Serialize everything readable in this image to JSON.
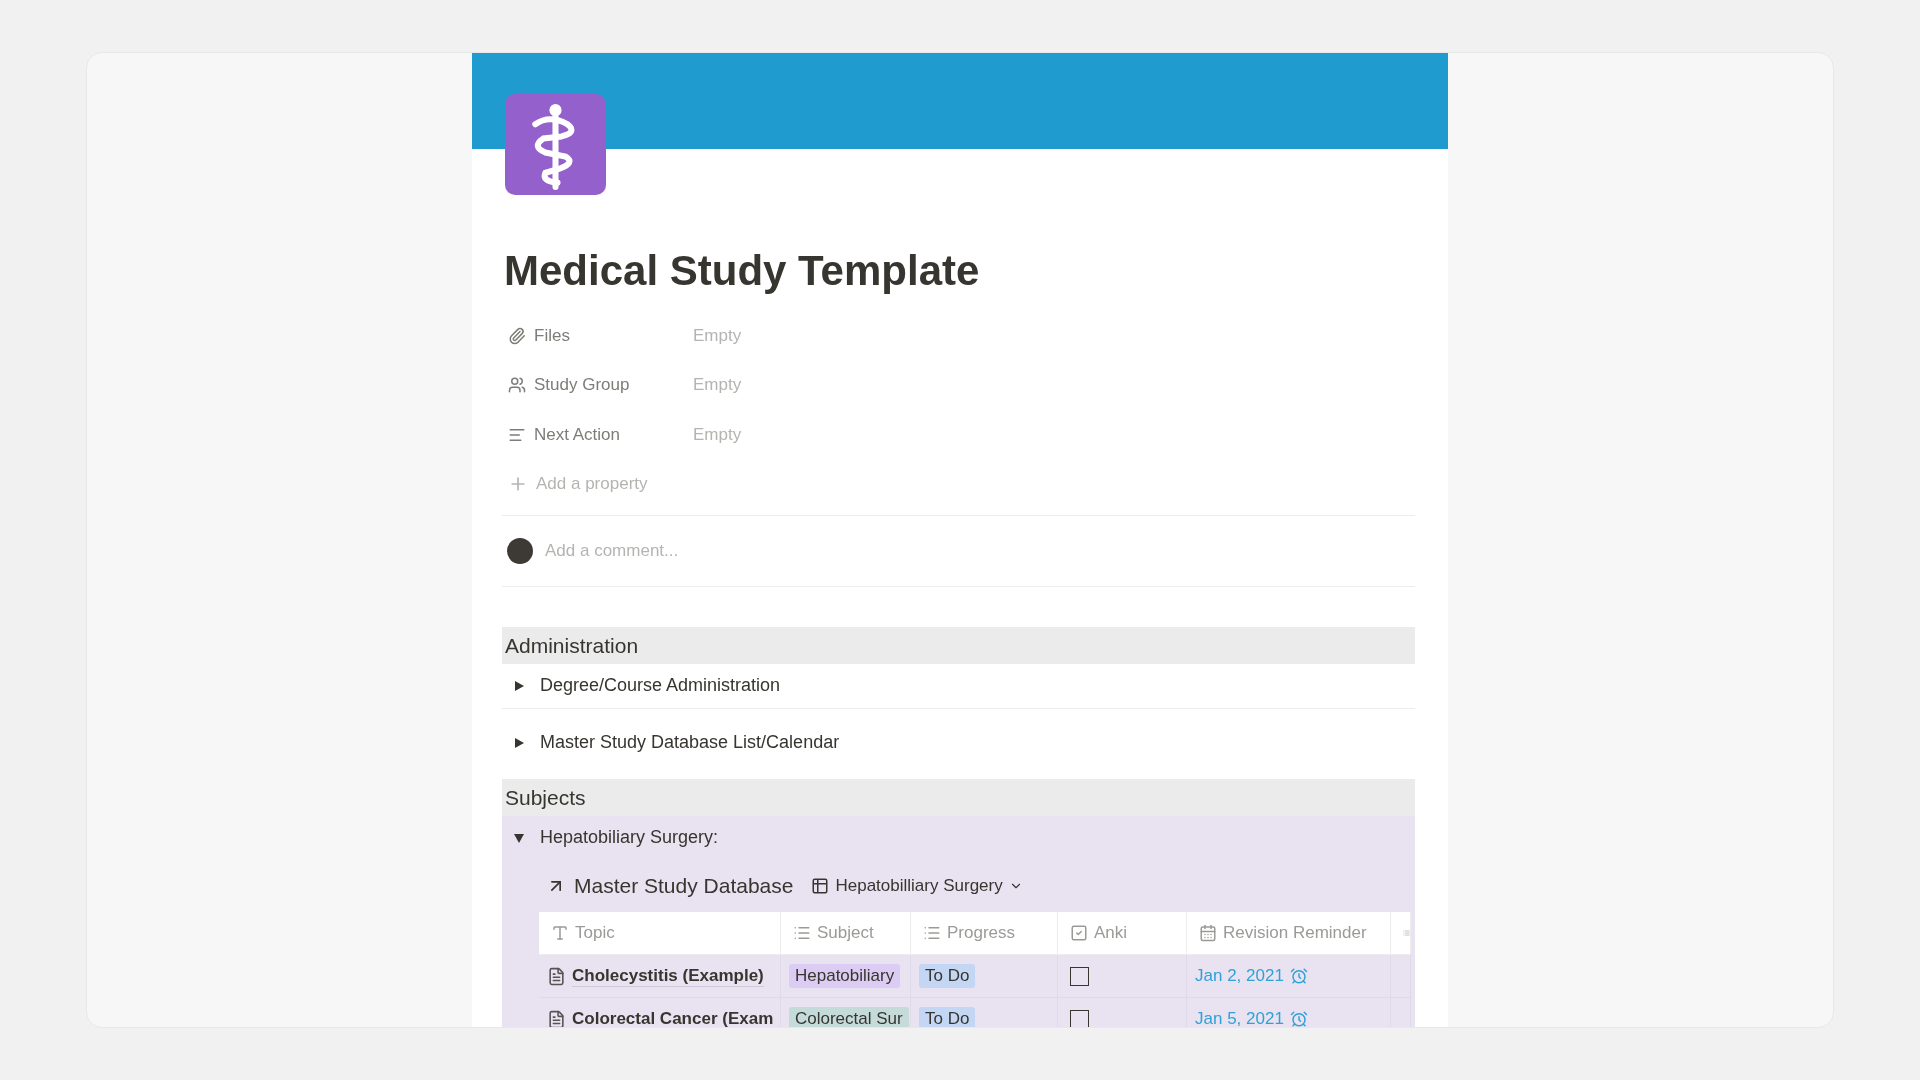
{
  "page": {
    "title": "Medical Study Template",
    "properties": [
      {
        "kind": "files",
        "label": "Files",
        "value": "Empty"
      },
      {
        "kind": "person",
        "label": "Study Group",
        "value": "Empty"
      },
      {
        "kind": "text",
        "label": "Next Action",
        "value": "Empty"
      }
    ],
    "add_property": "Add a property",
    "comment": {
      "placeholder": "Add a comment..."
    },
    "sections": [
      {
        "heading": "Administration",
        "toggles": [
          {
            "label": "Degree/Course Administration",
            "expanded": false
          },
          {
            "label": "Master Study Database List/Calendar",
            "expanded": false
          }
        ]
      },
      {
        "heading": "Subjects",
        "toggles": [
          {
            "label": "Hepatobiliary Surgery:",
            "expanded": true,
            "database": {
              "title": "Master Study Database",
              "view": "Hepatobilliary Surgery",
              "columns": [
                {
                  "kind": "title",
                  "label": "Topic"
                },
                {
                  "kind": "select",
                  "label": "Subject"
                },
                {
                  "kind": "select",
                  "label": "Progress"
                },
                {
                  "kind": "checkbox",
                  "label": "Anki"
                },
                {
                  "kind": "date",
                  "label": "Revision Reminder"
                },
                {
                  "kind": "select"
                }
              ],
              "rows": [
                {
                  "topic": "Cholecystitis (Example)",
                  "subject": {
                    "text": "Hepatobiliary",
                    "color": "#dccbf2"
                  },
                  "progress": {
                    "text": "To Do",
                    "color": "#c3d6f4"
                  },
                  "anki": false,
                  "revision": "Jan 2, 2021"
                },
                {
                  "topic": "Colorectal Cancer (Exam",
                  "subject": {
                    "text": "Colorectal Sur",
                    "color": "#c5dbda"
                  },
                  "progress": {
                    "text": "To Do",
                    "color": "#c3d6f4"
                  },
                  "anki": false,
                  "revision": "Jan 5, 2021"
                }
              ]
            }
          }
        ]
      }
    ]
  }
}
